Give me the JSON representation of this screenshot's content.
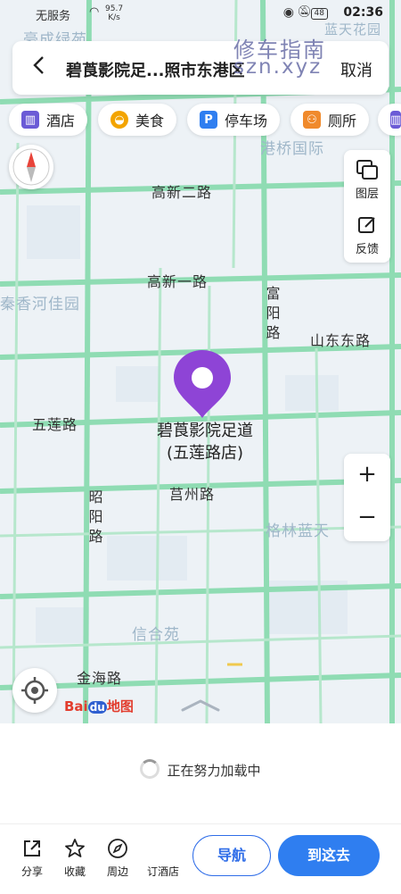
{
  "status_bar": {
    "carrier": "无服务",
    "net_speed_value": "95.7",
    "net_speed_unit": "K/s",
    "battery": "48",
    "time": "02:36"
  },
  "watermark": {
    "line1": "修车指南",
    "line2": "szn.xyz"
  },
  "search": {
    "title": "碧莨影院足...照市东港区",
    "cancel": "取消"
  },
  "chips": [
    {
      "label": "酒店",
      "icon": "hotel-icon",
      "color": "#6b5bd6"
    },
    {
      "label": "美食",
      "icon": "food-icon",
      "color": "#f3a400"
    },
    {
      "label": "停车场",
      "icon": "parking-icon",
      "color": "#2f7ef0"
    },
    {
      "label": "厕所",
      "icon": "toilet-icon",
      "color": "#f08a2c"
    }
  ],
  "side_panel": {
    "layers": "图层",
    "feedback": "反馈"
  },
  "zoom": {
    "plus": "+",
    "minus": "−"
  },
  "map_labels": {
    "haocheng": "豪成绿苑",
    "lantian": "蓝天花园",
    "gangqiao": "港桥国际",
    "gaoxin2": "高新二路",
    "gaoxin1": "高新一路",
    "xianghe": "秦香河佳园",
    "fuyang": "富阳路",
    "shandongdong": "山东东路",
    "wulian": "五莲路",
    "juzhou": "莒州路",
    "zhaoyang": "昭阳路",
    "gelin": "格林蓝天",
    "xinhe": "信合苑",
    "jinhai": "金海路"
  },
  "poi": {
    "name_line1": "碧莨影院足道",
    "name_line2": "(五莲路店)"
  },
  "brand": {
    "bai": "Bai",
    "du": "du",
    "ditu": "地图"
  },
  "sheet": {
    "loading": "正在努力加载中"
  },
  "bottom": {
    "share": "分享",
    "favorite": "收藏",
    "nearby": "周边",
    "book_hotel": "订酒店",
    "navigate": "导航",
    "go_here": "到这去"
  }
}
